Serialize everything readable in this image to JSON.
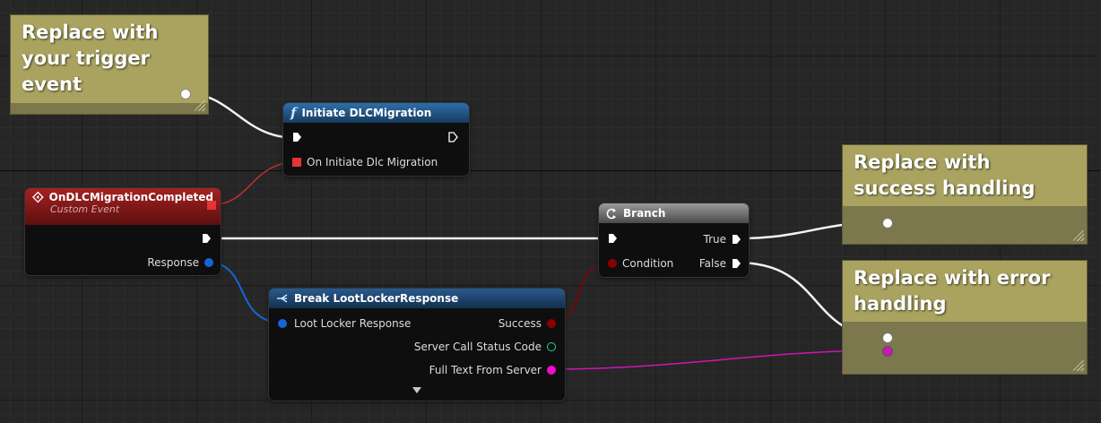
{
  "comments": {
    "trigger": "Replace with your trigger event",
    "success": "Replace with success handling",
    "error": "Replace with error handling"
  },
  "initiate_node": {
    "title": "Initiate DLCMigration",
    "icon": "function-icon",
    "param_label": "On Initiate Dlc Migration"
  },
  "custom_event_node": {
    "title": "OnDLCMigrationCompleted",
    "subtitle": "Custom Event",
    "response_label": "Response"
  },
  "branch_node": {
    "title": "Branch",
    "condition_label": "Condition",
    "true_label": "True",
    "false_label": "False"
  },
  "break_node": {
    "title": "Break LootLockerResponse",
    "input_label": "Loot Locker Response",
    "outputs": [
      "Success",
      "Server Call Status Code",
      "Full Text From Server"
    ]
  },
  "colors": {
    "exec_wire": "#ffffff",
    "struct_pin": "#1565d6",
    "bool_pin": "#8b0000",
    "int_pin": "#1ed3a3",
    "string_pin": "#f00ccd",
    "delegate_pin": "#e33535",
    "comment_header": "#a9a35f",
    "comment_body": "#7c774d"
  }
}
